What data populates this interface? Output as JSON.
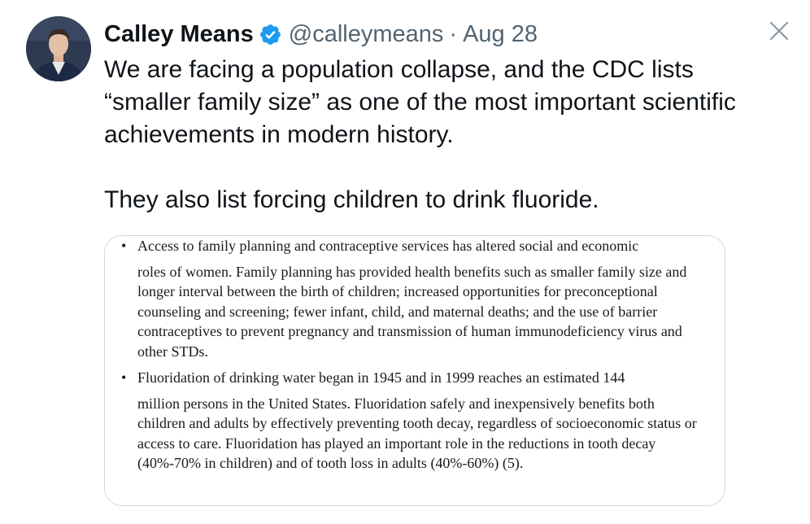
{
  "tweet": {
    "author_name": "Calley Means",
    "handle": "@calleymeans",
    "separator": "·",
    "date": "Aug 28",
    "paragraphs": [
      "We are facing a population collapse, and the CDC lists “smaller family size” as one of the most important scientific achievements in modern history.",
      "They also list forcing children to drink fluoride."
    ]
  },
  "icons": {
    "verified": "verified-badge-icon",
    "close": "close-icon"
  },
  "colors": {
    "verified_blue": "#1d9bf0",
    "text_primary": "#0f1419",
    "text_secondary": "#536471",
    "card_border": "#cfd9de"
  },
  "media_document": {
    "bullets": [
      {
        "marker": "•",
        "first_line": "Access to family planning and contraceptive services has altered social and economic",
        "rest": "roles of women. Family planning has provided health benefits such as smaller family size and longer interval between the birth of children; increased opportunities for preconceptional counseling and screening; fewer infant, child, and maternal deaths; and the use of barrier contraceptives to prevent pregnancy and transmission of human immunodeficiency virus and other STDs."
      },
      {
        "marker": "•",
        "first_line": "Fluoridation of drinking water began in 1945 and in 1999 reaches an estimated 144",
        "rest": "million persons in the United States. Fluoridation safely and inexpensively benefits both children and adults by effectively preventing tooth decay, regardless of socioeconomic status or access to care. Fluoridation has played an important role in the reductions in tooth decay (40%-70% in children) and of tooth loss in adults (40%-60%) (5)."
      }
    ]
  }
}
